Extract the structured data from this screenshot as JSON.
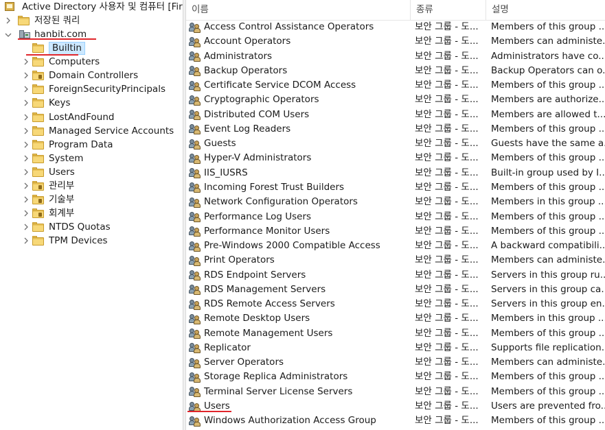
{
  "tree": {
    "root_label": "Active Directory 사용자 및 컴퓨터 [Firs",
    "saved_queries_label": "저장된 쿼리",
    "domain_label": "hanbit.com",
    "items": [
      {
        "label": "Builtin",
        "kind": "folder",
        "selected": true
      },
      {
        "label": "Computers",
        "kind": "folder"
      },
      {
        "label": "Domain Controllers",
        "kind": "ou"
      },
      {
        "label": "ForeignSecurityPrincipals",
        "kind": "folder"
      },
      {
        "label": "Keys",
        "kind": "folder"
      },
      {
        "label": "LostAndFound",
        "kind": "folder"
      },
      {
        "label": "Managed Service Accounts",
        "kind": "folder"
      },
      {
        "label": "Program Data",
        "kind": "folder"
      },
      {
        "label": "System",
        "kind": "folder"
      },
      {
        "label": "Users",
        "kind": "folder"
      },
      {
        "label": "관리부",
        "kind": "ou"
      },
      {
        "label": "기술부",
        "kind": "ou"
      },
      {
        "label": "회계부",
        "kind": "ou"
      },
      {
        "label": "NTDS Quotas",
        "kind": "folder"
      },
      {
        "label": "TPM Devices",
        "kind": "folder"
      }
    ]
  },
  "list": {
    "columns": {
      "name": "이름",
      "type": "종류",
      "description": "설명"
    },
    "rows": [
      {
        "name": "Access Control Assistance Operators",
        "type": "보안 그룹 - 도...",
        "description": "Members of this group ..."
      },
      {
        "name": "Account Operators",
        "type": "보안 그룹 - 도...",
        "description": "Members can administe..."
      },
      {
        "name": "Administrators",
        "type": "보안 그룹 - 도...",
        "description": "Administrators have co..."
      },
      {
        "name": "Backup Operators",
        "type": "보안 그룹 - 도...",
        "description": "Backup Operators can o..."
      },
      {
        "name": "Certificate Service DCOM Access",
        "type": "보안 그룹 - 도...",
        "description": "Members of this group ..."
      },
      {
        "name": "Cryptographic Operators",
        "type": "보안 그룹 - 도...",
        "description": "Members are authorize..."
      },
      {
        "name": "Distributed COM Users",
        "type": "보안 그룹 - 도...",
        "description": "Members are allowed t..."
      },
      {
        "name": "Event Log Readers",
        "type": "보안 그룹 - 도...",
        "description": "Members of this group ..."
      },
      {
        "name": "Guests",
        "type": "보안 그룹 - 도...",
        "description": "Guests have the same a..."
      },
      {
        "name": "Hyper-V Administrators",
        "type": "보안 그룹 - 도...",
        "description": "Members of this group ..."
      },
      {
        "name": "IIS_IUSRS",
        "type": "보안 그룹 - 도...",
        "description": "Built-in group used by I..."
      },
      {
        "name": "Incoming Forest Trust Builders",
        "type": "보안 그룹 - 도...",
        "description": "Members of this group ..."
      },
      {
        "name": "Network Configuration Operators",
        "type": "보안 그룹 - 도...",
        "description": "Members in this group ..."
      },
      {
        "name": "Performance Log Users",
        "type": "보안 그룹 - 도...",
        "description": "Members of this group ..."
      },
      {
        "name": "Performance Monitor Users",
        "type": "보안 그룹 - 도...",
        "description": "Members of this group ..."
      },
      {
        "name": "Pre-Windows 2000 Compatible Access",
        "type": "보안 그룹 - 도...",
        "description": "A backward compatibili..."
      },
      {
        "name": "Print Operators",
        "type": "보안 그룹 - 도...",
        "description": "Members can administe..."
      },
      {
        "name": "RDS Endpoint Servers",
        "type": "보안 그룹 - 도...",
        "description": "Servers in this group ru..."
      },
      {
        "name": "RDS Management Servers",
        "type": "보안 그룹 - 도...",
        "description": "Servers in this group ca..."
      },
      {
        "name": "RDS Remote Access Servers",
        "type": "보안 그룹 - 도...",
        "description": "Servers in this group en..."
      },
      {
        "name": "Remote Desktop Users",
        "type": "보안 그룹 - 도...",
        "description": "Members in this group ..."
      },
      {
        "name": "Remote Management Users",
        "type": "보안 그룹 - 도...",
        "description": "Members of this group ..."
      },
      {
        "name": "Replicator",
        "type": "보안 그룹 - 도...",
        "description": "Supports file replication..."
      },
      {
        "name": "Server Operators",
        "type": "보안 그룹 - 도...",
        "description": "Members can administe..."
      },
      {
        "name": "Storage Replica Administrators",
        "type": "보안 그룹 - 도...",
        "description": "Members of this group ..."
      },
      {
        "name": "Terminal Server License Servers",
        "type": "보안 그룹 - 도...",
        "description": "Members of this group ..."
      },
      {
        "name": "Users",
        "type": "보안 그룹 - 도...",
        "description": "Users are prevented fro..."
      },
      {
        "name": "Windows Authorization Access Group",
        "type": "보안 그룹 - 도...",
        "description": "Members of this group ..."
      }
    ]
  },
  "icons": {
    "tree_root": "snapin-icon",
    "domain": "domain-icon",
    "folder": "folder-icon",
    "ou": "ou-folder-icon",
    "group": "group-icon"
  },
  "annotation_color": "#e0252a"
}
